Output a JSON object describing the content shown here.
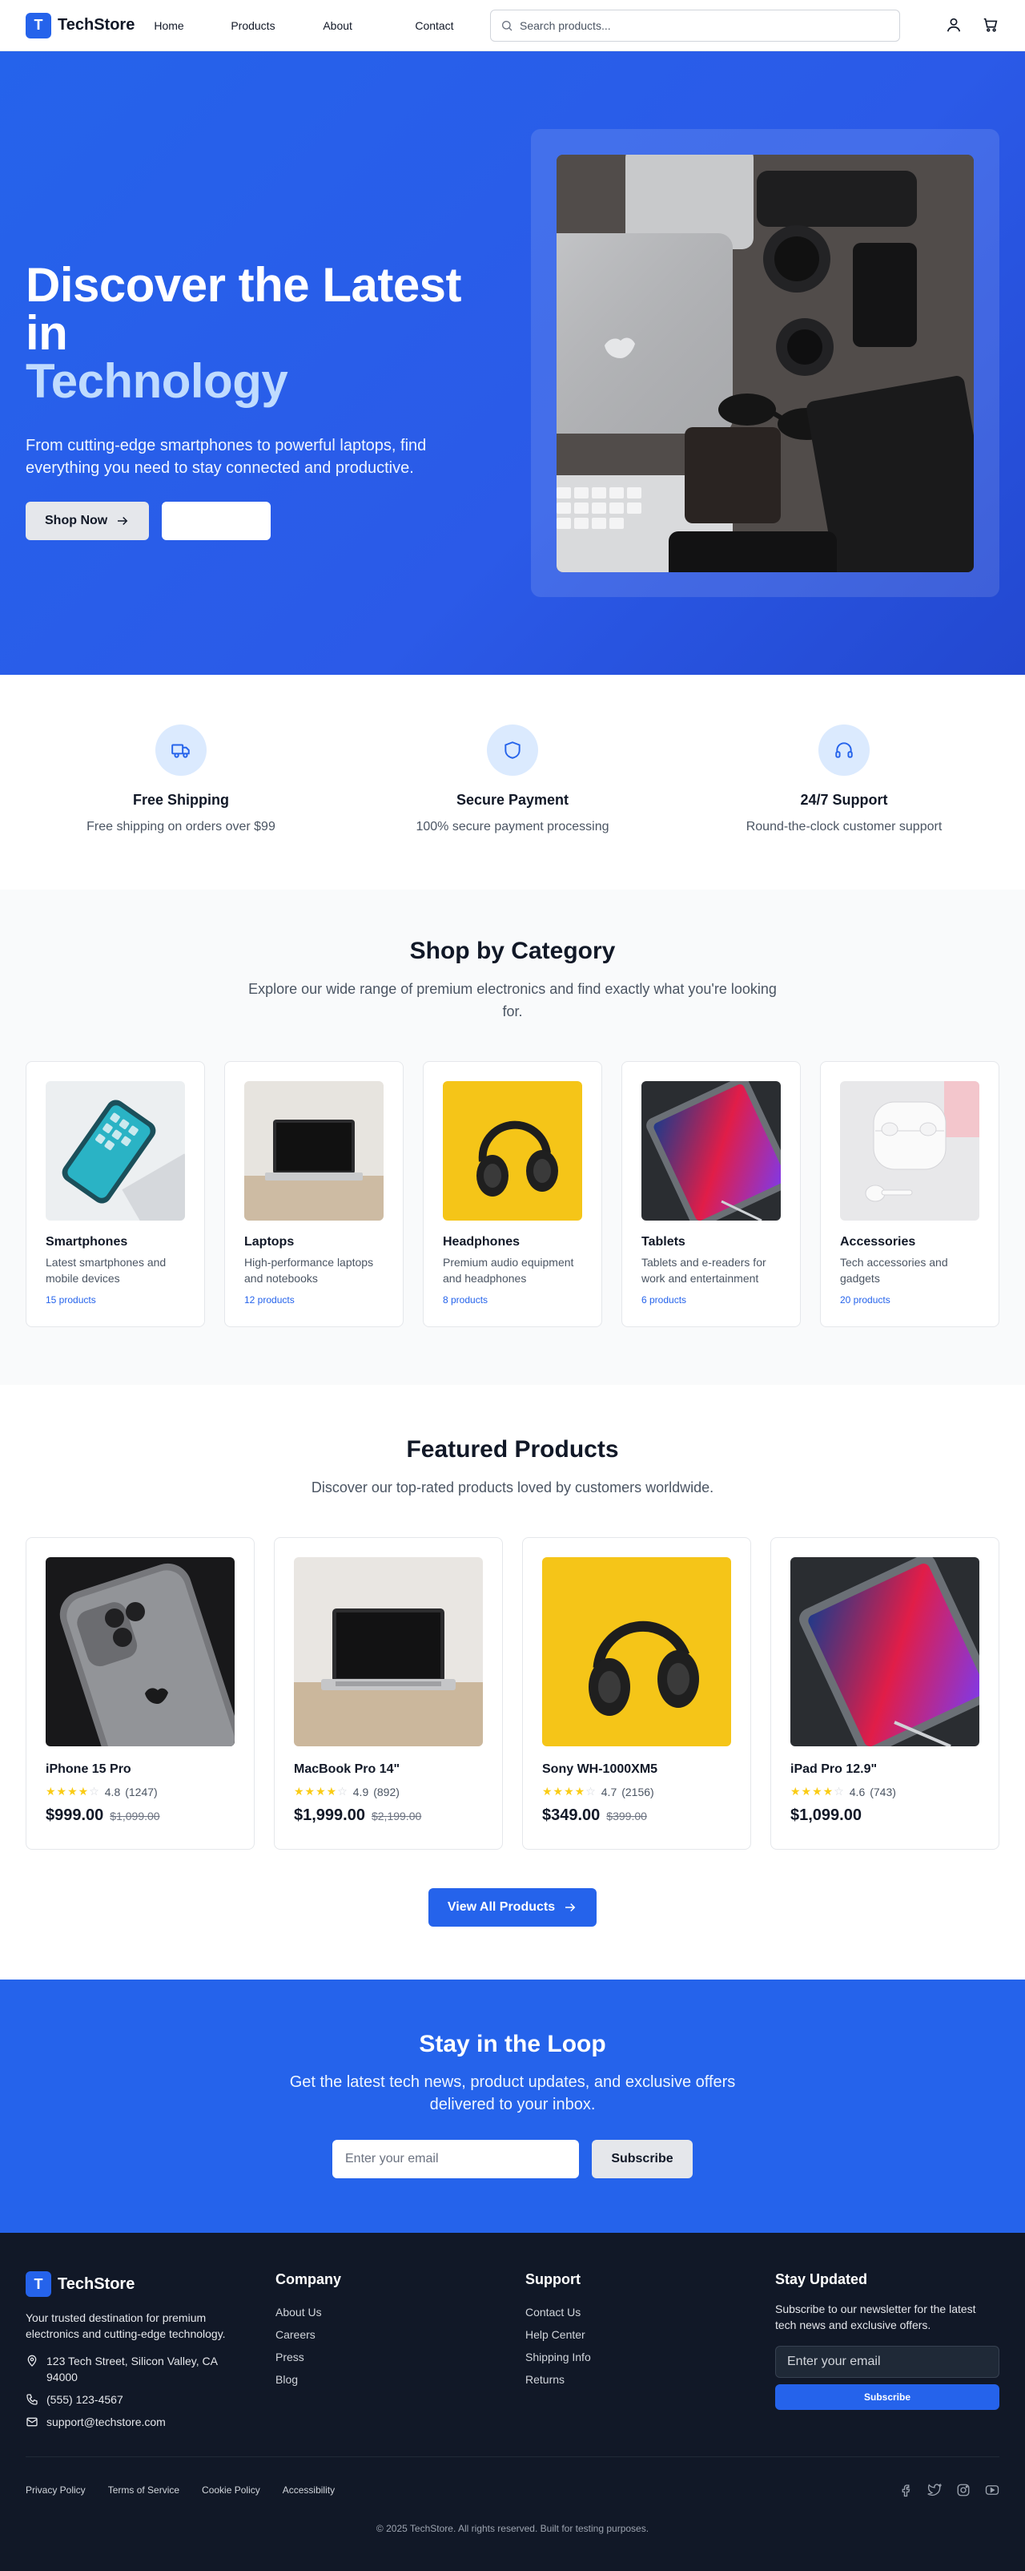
{
  "brand": {
    "logo_letter": "T",
    "name": "TechStore"
  },
  "nav": {
    "links": [
      "Home",
      "Products",
      "About",
      "Contact"
    ],
    "search_placeholder": "Search products..."
  },
  "hero": {
    "title_line1": "Discover the Latest",
    "title_line2": "in",
    "title_accent": "Technology",
    "subtitle": "From cutting-edge smartphones to powerful laptops, find everything you need to stay connected and productive.",
    "primary_cta": "Shop Now"
  },
  "features": [
    {
      "icon": "truck-icon",
      "title": "Free Shipping",
      "desc": "Free shipping on orders over $99"
    },
    {
      "icon": "shield-icon",
      "title": "Secure Payment",
      "desc": "100% secure payment processing"
    },
    {
      "icon": "headphones-icon",
      "title": "24/7 Support",
      "desc": "Round-the-clock customer support"
    }
  ],
  "categories": {
    "title": "Shop by Category",
    "subtitle": "Explore our wide range of premium electronics and find exactly what you're looking for.",
    "items": [
      {
        "name": "Smartphones",
        "desc": "Latest smartphones and mobile devices",
        "count": "15 products"
      },
      {
        "name": "Laptops",
        "desc": "High-performance laptops and notebooks",
        "count": "12 products"
      },
      {
        "name": "Headphones",
        "desc": "Premium audio equipment and headphones",
        "count": "8 products"
      },
      {
        "name": "Tablets",
        "desc": "Tablets and e-readers for work and entertainment",
        "count": "6 products"
      },
      {
        "name": "Accessories",
        "desc": "Tech accessories and gadgets",
        "count": "20 products"
      }
    ]
  },
  "featured": {
    "title": "Featured Products",
    "subtitle": "Discover our top-rated products loved by customers worldwide.",
    "products": [
      {
        "name": "iPhone 15 Pro",
        "rating": "4.8",
        "reviews": "(1247)",
        "price": "$999.00",
        "old_price": "$1,099.00"
      },
      {
        "name": "MacBook Pro 14\"",
        "rating": "4.9",
        "reviews": "(892)",
        "price": "$1,999.00",
        "old_price": "$2,199.00"
      },
      {
        "name": "Sony WH-1000XM5",
        "rating": "4.7",
        "reviews": "(2156)",
        "price": "$349.00",
        "old_price": "$399.00"
      },
      {
        "name": "iPad Pro 12.9\"",
        "rating": "4.6",
        "reviews": "(743)",
        "price": "$1,099.00",
        "old_price": ""
      }
    ],
    "view_all": "View All Products"
  },
  "newsletter": {
    "title": "Stay in the Loop",
    "subtitle": "Get the latest tech news, product updates, and exclusive offers delivered to your inbox.",
    "placeholder": "Enter your email",
    "button": "Subscribe"
  },
  "footer": {
    "tagline": "Your trusted destination for premium electronics and cutting-edge technology.",
    "address": "123 Tech Street, Silicon Valley, CA 94000",
    "phone": "(555) 123-4567",
    "email": "support@techstore.com",
    "company": {
      "heading": "Company",
      "links": [
        "About Us",
        "Careers",
        "Press",
        "Blog"
      ]
    },
    "support": {
      "heading": "Support",
      "links": [
        "Contact Us",
        "Help Center",
        "Shipping Info",
        "Returns"
      ]
    },
    "updates": {
      "heading": "Stay Updated",
      "text": "Subscribe to our newsletter for the latest tech news and exclusive offers.",
      "placeholder": "Enter your email",
      "button": "Subscribe"
    },
    "legal": [
      "Privacy Policy",
      "Terms of Service",
      "Cookie Policy",
      "Accessibility"
    ],
    "social_icons": [
      "facebook-icon",
      "twitter-icon",
      "instagram-icon",
      "youtube-icon"
    ],
    "copyright": "© 2025 TechStore. All rights reserved. Built for testing purposes."
  },
  "colors": {
    "primary": "#2563eb",
    "dark": "#111827",
    "star": "#facc15"
  }
}
